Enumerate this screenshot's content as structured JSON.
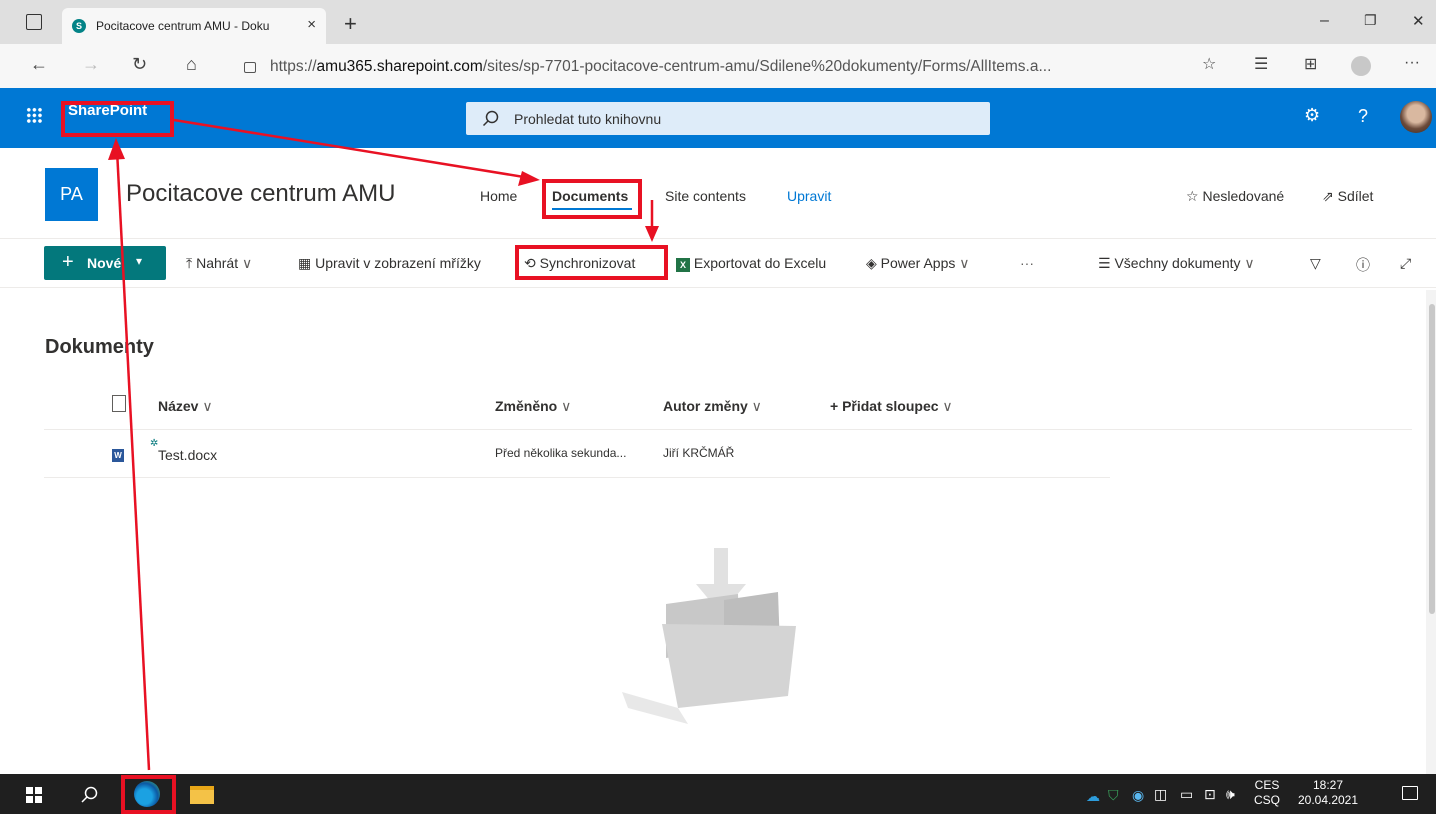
{
  "browser": {
    "tab_title": "Pocitacove centrum AMU - Doku",
    "tab_close": "×",
    "new_tab": "+",
    "url_prefix": "https://",
    "url_host": "amu365.sharepoint.com",
    "url_path": "/sites/sp-7701-pocitacove-centrum-amu/Sdilene%20dokumenty/Forms/AllItems.a...",
    "window_controls": [
      "–",
      "❐",
      "✕"
    ]
  },
  "suitebar": {
    "app_name": "SharePoint",
    "search_placeholder": "Prohledat tuto knihovnu"
  },
  "site": {
    "logo_text": "PA",
    "title": "Pocitacove centrum AMU",
    "nav": [
      "Home",
      "Documents",
      "Site contents",
      "Upravit"
    ],
    "follow": "Nesledované",
    "share": "Sdílet"
  },
  "commandbar": {
    "new": "Nové",
    "upload": "Nahrát",
    "grid_edit": "Upravit v zobrazení mřížky",
    "sync": "Synchronizovat",
    "export": "Exportovat do Excelu",
    "power_apps": "Power Apps",
    "more": "···",
    "view": "Všechny dokumenty"
  },
  "library": {
    "title": "Dokumenty",
    "columns": [
      "Název",
      "Změněno",
      "Autor změny",
      "+ Přidat sloupec"
    ],
    "rows": [
      {
        "name": "Test.docx",
        "modified": "Před několika sekunda...",
        "author": "Jiří KRČMÁŘ"
      }
    ]
  },
  "taskbar": {
    "lang_top": "CES",
    "lang_bottom": "CSQ",
    "time": "18:27",
    "date": "20.04.2021"
  },
  "colors": {
    "suite_blue": "#0078d4",
    "teal": "#03787c",
    "highlight_red": "#e81123"
  }
}
